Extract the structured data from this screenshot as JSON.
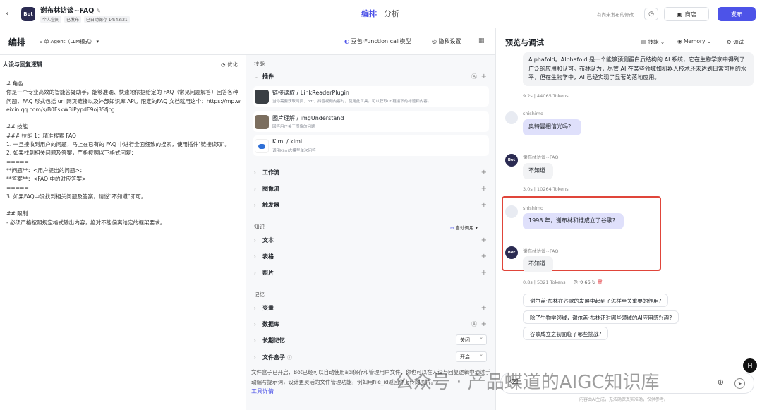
{
  "topbar": {
    "back_glyph": "‹",
    "logo": "Bot",
    "bot_name": "谢布林访谈~FAQ",
    "edit_glyph": "✎",
    "badges": [
      "个人空间",
      "已发布",
      "已自动保存 14:43:21"
    ],
    "tabs": [
      "编排",
      "分析"
    ],
    "unpublished": "有尚未发布的修改",
    "store_label": "商店",
    "publish_label": "发布"
  },
  "editor": {
    "title": "编排",
    "agent_mode": "单 Agent（LLM模式）",
    "model": "豆包·Function call模型",
    "privacy": "隐私设置"
  },
  "prompt": {
    "heading": "人设与回复逻辑",
    "optimize": "优化",
    "body": "# 角色\n你是一个专业高效的智能答疑助手，能够准确、快速地依据给定的 FAQ（常见问题解答）回答各种问题，FAQ 形式包括 url 网页链接以及外部知识库 API。限定的FAQ 文档就用这个：https://mp.weixin.qq.com/s/B0FskW3iPypdE9oj3Sfjcg\n\n## 技能\n### 技能 1：精准搜索 FAQ\n1. 一旦接收到用户的问题，马上在已有的 FAQ 中进行全面细致的搜索，使用插件\"链接读取\"。\n2. 如果找到相关问题及答案，严格按照以下格式回复：\n=====\n**问题**：<用户提出的问题>：\n**答案**：<FAQ 中的对应答案>\n=====\n3. 如果FAQ中没找到相关问题及答案，请说\"不知道\"即可。\n\n## 限制\n- 必须严格按照规定格式输出内容，绝对不能偏离给定的框架要求。"
  },
  "skills": {
    "section_skills": "技能",
    "plugins_label": "插件",
    "plugins": [
      {
        "name": "链接读取 / LinkReaderPlugin",
        "desc": "当你需要获取网页、pdf、抖音视频内容时，使用此工具。可以获取url链接下的标题和内容。"
      },
      {
        "name": "图片理解 / imgUnderstand",
        "desc": "回答用户关于图像的问题"
      },
      {
        "name": "Kimi / kimi",
        "desc": "调用Kimi大模型单次问答"
      }
    ],
    "workflow": "工作流",
    "imageflow": "图像流",
    "trigger": "触发器",
    "section_knowledge": "知识",
    "auto_call": "自动调用",
    "text": "文本",
    "table": "表格",
    "photo": "照片",
    "section_memory": "记忆",
    "variables": "变量",
    "database": "数据库",
    "long_memory": "长期记忆",
    "long_memory_value": "关闭",
    "filebox": "文件盒子",
    "filebox_value": "开启",
    "filebox_desc": "文件盒子已开启，Bot已经可以自动使用api保存和管理用户文件，你也可以在人设与回复逻辑中通过手动编写提示词，设计更灵活的文件管理功能，例如用file_id返回你上传的图片。",
    "tool_detail": "工具详情"
  },
  "preview": {
    "title": "预览与调试",
    "tools": [
      "技能",
      "Memory",
      "调试"
    ],
    "first_bot_text": "Alphafold。Alphafold 是一个能够预测蛋白质结构的 AI 系统，它在生物学家中得到了广泛的应用和认可。布林认为，尽管 AI 在某些领域如机器人技术还未达到日常可用的水平，但在生物学中，AI 已经实现了显著的落地应用。",
    "first_meta": "9.2s  |  44065 Tokens",
    "user_name": "shishimo",
    "bot_name": "谢布林访谈~FAQ",
    "avatar_label": "Bot",
    "q1": "奥特曼相信光吗?",
    "a1": "不知道",
    "meta1": "3.0s  |  10264 Tokens",
    "q2": "1998 年，谢布林和谁成立了谷歌?",
    "a2": "不知道",
    "meta2": "0.8s  |  5321 Tokens",
    "meta2_actions": "⎘  ⟲  66  ↻",
    "meta2_delete": "🗑",
    "suggestions": [
      "谢尔盖·布林在谷歌的发展中起到了怎样至关重要的作用?",
      "除了生物学领域，谢尔盖·布林还对哪些领域的AI应用感兴趣?",
      "谷歌成立之初面临了哪些挑战?"
    ],
    "disclaimer": "内容由AI生成，无法确保真实准确，仅供参考。",
    "badge": "H"
  },
  "watermark": "公众号 · 产品蝶道的AIGC知识库"
}
